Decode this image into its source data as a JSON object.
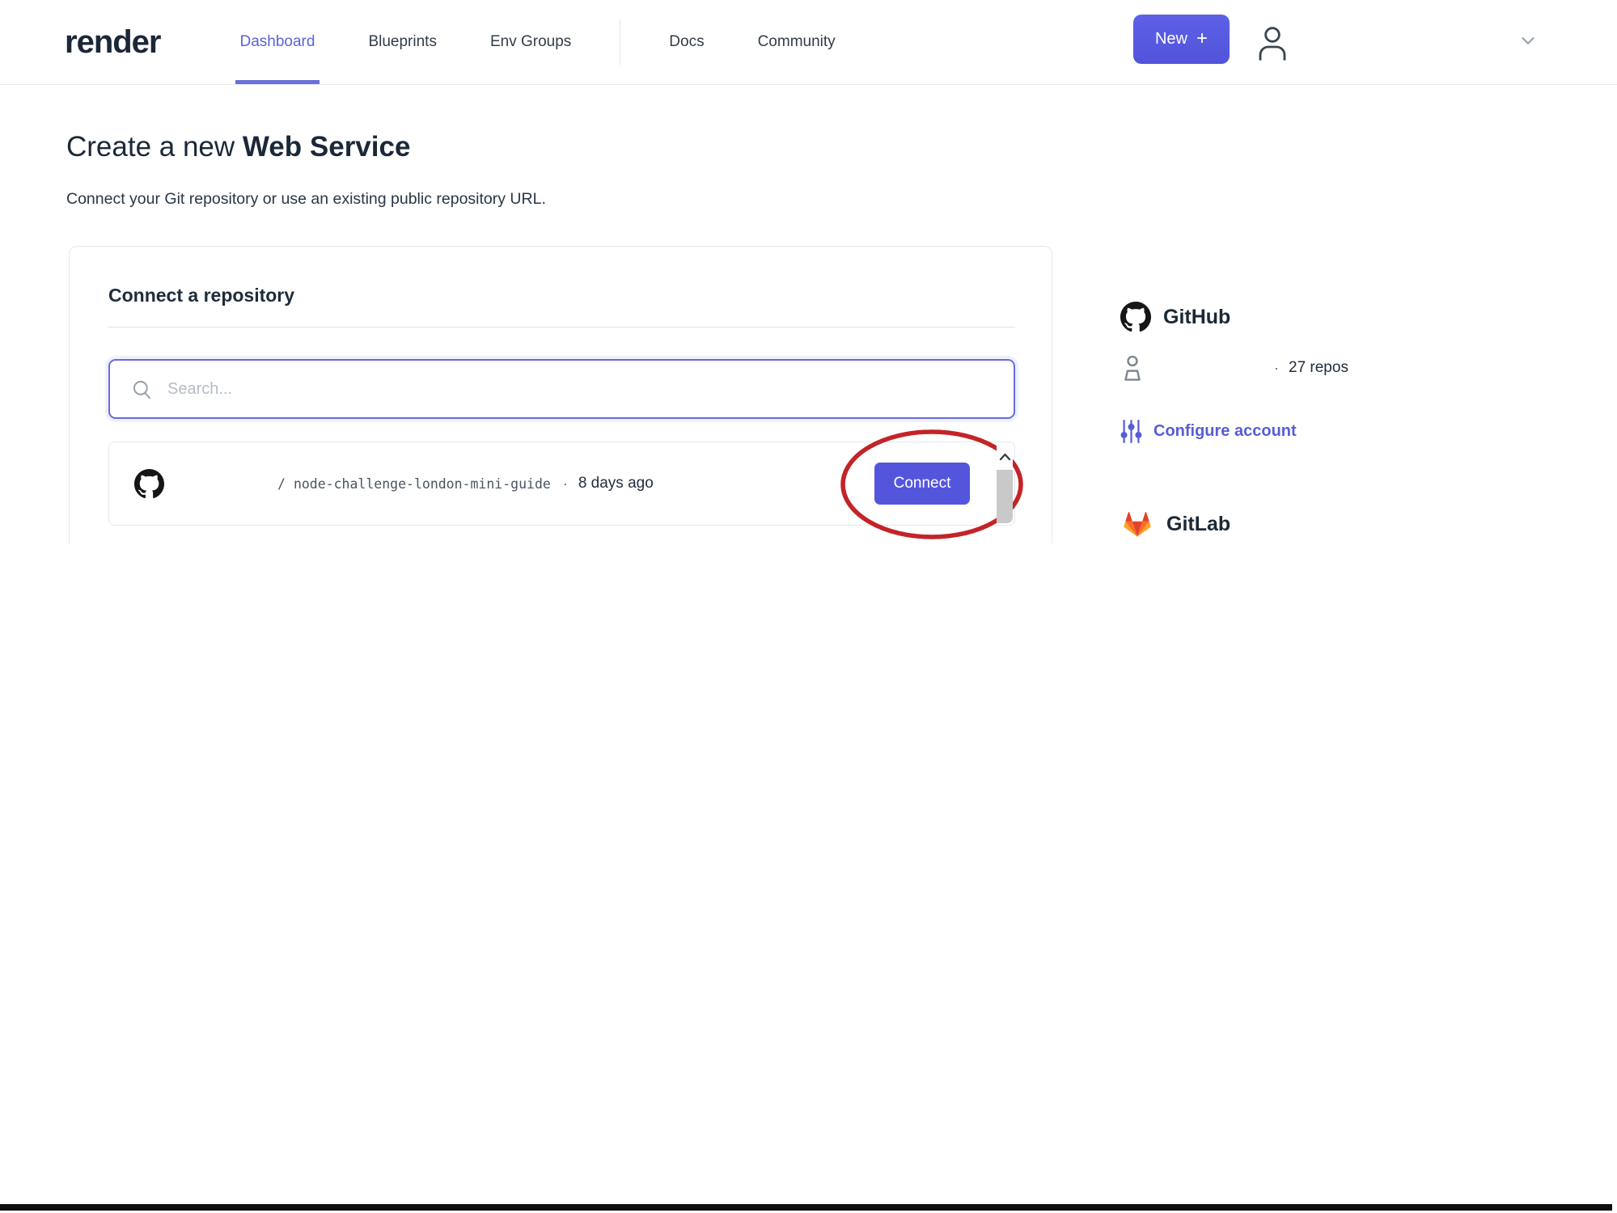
{
  "brand": {
    "logo": "render"
  },
  "nav": {
    "items": [
      {
        "label": "Dashboard",
        "active": true
      },
      {
        "label": "Blueprints",
        "active": false
      },
      {
        "label": "Env Groups",
        "active": false
      },
      {
        "label": "Docs",
        "active": false
      },
      {
        "label": "Community",
        "active": false
      }
    ],
    "new_button_label": "New",
    "new_button_plus": "+"
  },
  "page": {
    "title_regular": "Create a new ",
    "title_bold": "Web Service",
    "subtitle": "Connect your Git repository or use an existing public repository URL."
  },
  "card": {
    "title": "Connect a repository",
    "search_placeholder": "Search...",
    "repo": {
      "path_prefix": "/",
      "name": "node-challenge-london-mini-guide",
      "separator": "·",
      "updated": "8 days ago",
      "connect_label": "Connect"
    }
  },
  "providers": {
    "github": {
      "title": "GitHub",
      "separator": "·",
      "repos_count": "27 repos",
      "configure_label": "Configure account"
    },
    "gitlab": {
      "title": "GitLab"
    }
  },
  "icons": {
    "search": "magnifier glyph",
    "github": "octocat mark",
    "gitlab": "tanuki fox mark",
    "user": "person outline",
    "sliders": "vertical sliders",
    "chevron_down": "v chevron",
    "scroll_up": "^ chevron",
    "annotation": "red ellipse highlight"
  },
  "colors": {
    "accent_purple": "#5356dd",
    "nav_active": "#5b63d6",
    "annotation_red": "#c32428",
    "gitlab_orange_dark": "#e24329",
    "gitlab_orange": "#fc6d26",
    "gitlab_yellow": "#fca326",
    "bottom_bar": "#0e0e0e"
  }
}
